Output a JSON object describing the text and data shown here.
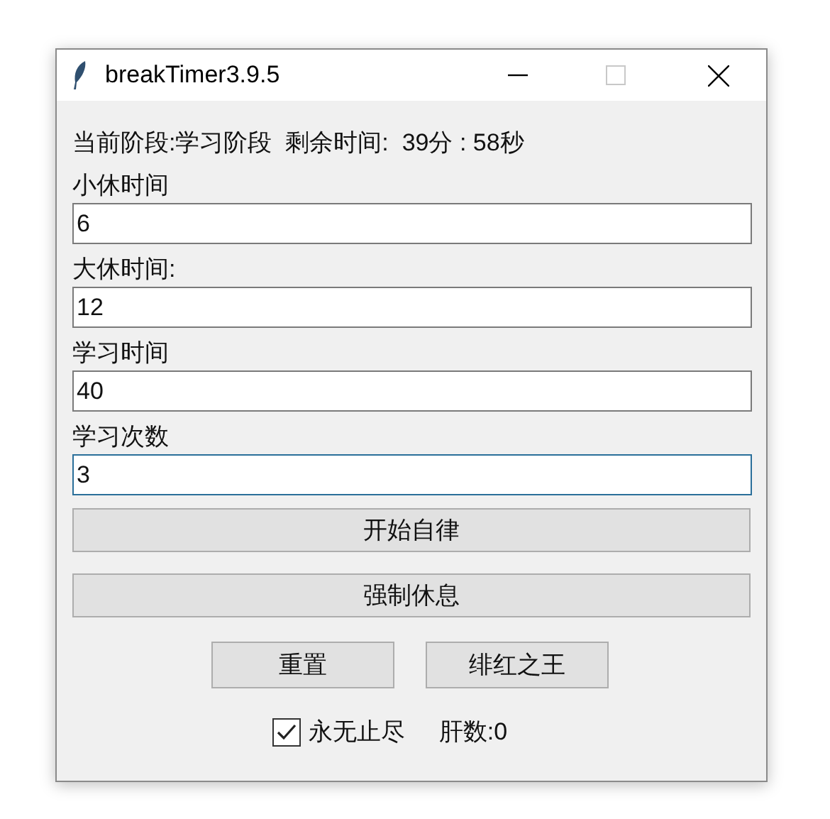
{
  "window": {
    "title": "breakTimer3.9.5"
  },
  "status": "当前阶段:学习阶段  剩余时间:  39分 : 58秒",
  "fields": [
    {
      "label": "小休时间",
      "value": "6",
      "focused": false
    },
    {
      "label": "大休时间:",
      "value": "12",
      "focused": false
    },
    {
      "label": "学习时间",
      "value": "40",
      "focused": false
    },
    {
      "label": "学习次数",
      "value": "3",
      "focused": true
    }
  ],
  "wide_buttons": [
    "开始自律",
    "强制休息"
  ],
  "small_buttons": [
    "重置",
    "绯红之王"
  ],
  "checkbox": {
    "label": "永无止尽",
    "checked": true
  },
  "counter": "肝数:0"
}
